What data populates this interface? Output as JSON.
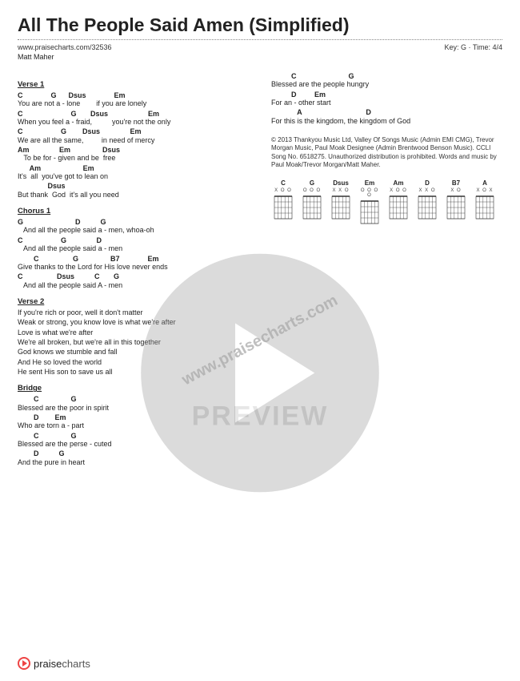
{
  "title": "All The People Said Amen (Simplified)",
  "source_url": "www.praisecharts.com/32536",
  "key_time": "Key: G · Time: 4/4",
  "artist": "Matt Maher",
  "watermark_url": "www.praisecharts.com",
  "preview_label": "PREVIEW",
  "footer": {
    "brand_prefix": "praise",
    "brand_suffix": "charts"
  },
  "left_sections": [
    {
      "label": "Verse 1",
      "lines": [
        {
          "chords": "C              G      Dsus              Em",
          "lyric": "You are not a - lone        if you are lonely"
        },
        {
          "chords": "C                        G       Dsus                    Em",
          "lyric": "When you feel a - fraid,          you're not the only"
        },
        {
          "chords": "C                   G        Dsus               Em",
          "lyric": "We are all the same,         in need of mercy"
        },
        {
          "chords": "Am               Em                Dsus",
          "lyric": "   To be for - given and be  free"
        },
        {
          "chords": "      Am                     Em",
          "lyric": "It's  all  you've got to lean on"
        },
        {
          "chords": "               Dsus",
          "lyric": "But thank  God  it's all you need"
        }
      ]
    },
    {
      "label": "Chorus 1",
      "lines": [
        {
          "chords": "G                          D          G",
          "lyric": "   And all the people said a - men, whoa-oh"
        },
        {
          "chords": "C                   G               D",
          "lyric": "   And all the people said a - men"
        },
        {
          "chords": "        C                 G                B7              Em",
          "lyric": "Give thanks to the Lord for His love never ends"
        },
        {
          "chords": "C                 Dsus          C       G",
          "lyric": "   And all the people said A - men"
        }
      ]
    },
    {
      "label": "Verse 2",
      "lines": [
        {
          "chords": "",
          "lyric": "If you're rich or poor, well it don't matter"
        },
        {
          "chords": "",
          "lyric": "Weak or strong, you know love is what we're after"
        },
        {
          "chords": "",
          "lyric": "Love is what we're after"
        },
        {
          "chords": "",
          "lyric": "We're all broken, but we're all in this together"
        },
        {
          "chords": "",
          "lyric": "God knows we stumble and fall"
        },
        {
          "chords": "",
          "lyric": "And He so loved the world"
        },
        {
          "chords": "",
          "lyric": "He sent His son to save us all"
        }
      ]
    },
    {
      "label": "Bridge",
      "lines": [
        {
          "chords": "        C                G",
          "lyric": "Blessed are the poor in spirit"
        },
        {
          "chords": "        D        Em",
          "lyric": "Who are torn a - part"
        },
        {
          "chords": "        C                G",
          "lyric": "Blessed are the perse - cuted"
        },
        {
          "chords": "        D          G",
          "lyric": "And the pure in heart"
        }
      ]
    }
  ],
  "right_sections": [
    {
      "label": null,
      "lines": [
        {
          "chords": "          C                          G",
          "lyric": "Blessed are the people hungry"
        },
        {
          "chords": "          D         Em",
          "lyric": "For an - other start"
        },
        {
          "chords": "             A                                D",
          "lyric": "For this is the kingdom, the kingdom of God"
        }
      ]
    }
  ],
  "copyright": "© 2013 Thankyou Music Ltd, Valley Of Songs Music (Admin EMI CMG), Trevor Morgan Music, Paul Moak Designee (Admin Brentwood Benson Music). CCLI Song No. 6518275. Unauthorized distribution is prohibited. Words and music by Paul Moak/Trevor Morgan/Matt Maher.",
  "chord_diagrams": [
    "C",
    "G",
    "Dsus",
    "Em",
    "Am",
    "D",
    "B7",
    "A"
  ],
  "fret_row": {
    "C": "X   O O",
    "G": "  O O O",
    "Dsus": "X X O  ",
    "Em": "O   O O O",
    "Am": "X O   O",
    "D": "X X O  ",
    "B7": "X   O  ",
    "A": "X O   X"
  },
  "chart_data": null
}
